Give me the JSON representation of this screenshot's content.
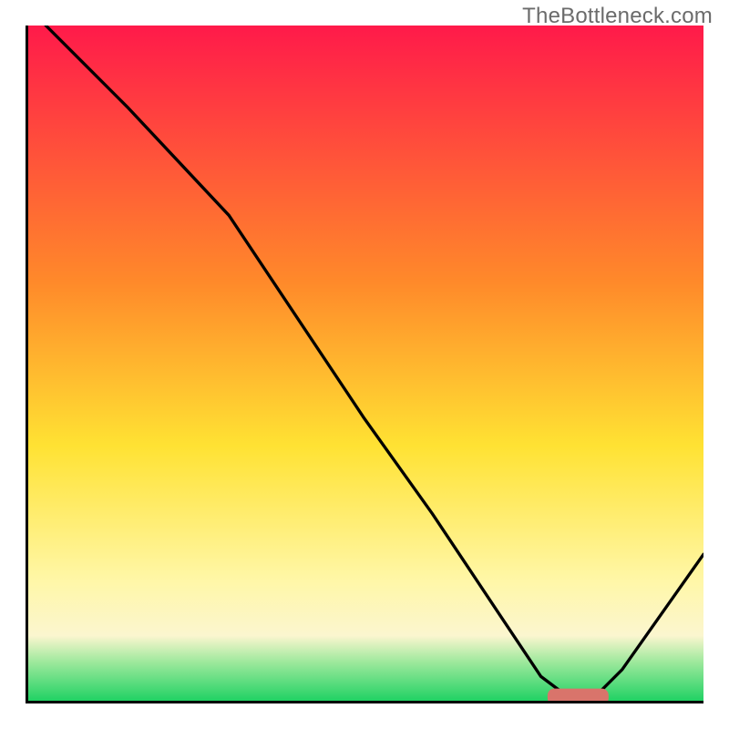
{
  "watermark": "TheBottleneck.com",
  "colors": {
    "red": "#ff1a4a",
    "orange": "#ff8a2a",
    "yellow": "#ffe233",
    "paleyellow": "#fff7a8",
    "cream": "#fbf6cf",
    "green_light": "#9be89b",
    "green": "#18d060",
    "curve": "#000000",
    "marker": "#d9746b",
    "axis": "#000000"
  },
  "chart_data": {
    "type": "line",
    "title": "",
    "xlabel": "",
    "ylabel": "",
    "xlim": [
      0,
      100
    ],
    "ylim": [
      0,
      100
    ],
    "x": [
      3,
      8,
      15,
      22.5,
      30,
      40,
      50,
      60,
      70,
      76,
      80,
      84,
      88,
      100
    ],
    "series": [
      {
        "name": "bottleneck_curve",
        "values": [
          100,
          95,
          88,
          80,
          72,
          57,
          42,
          28,
          13,
          4,
          1,
          1,
          5,
          22
        ]
      }
    ],
    "marker": {
      "x_start": 77,
      "x_end": 86,
      "y": 1
    },
    "gradient_stops_pct": [
      {
        "at": 0,
        "color": "red"
      },
      {
        "at": 38,
        "color": "orange"
      },
      {
        "at": 62,
        "color": "yellow"
      },
      {
        "at": 82,
        "color": "paleyellow"
      },
      {
        "at": 90,
        "color": "cream"
      },
      {
        "at": 94,
        "color": "green_light"
      },
      {
        "at": 100,
        "color": "green"
      }
    ]
  }
}
